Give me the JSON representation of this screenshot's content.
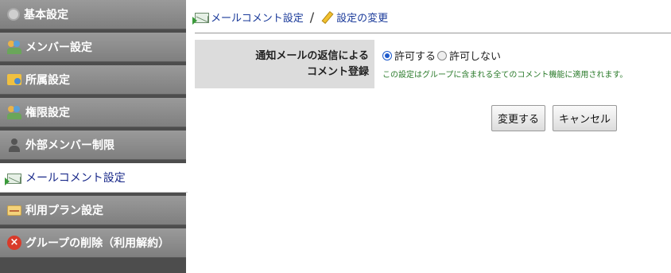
{
  "sidebar": {
    "items": [
      {
        "label": "基本設定",
        "icon": "gear-icon"
      },
      {
        "label": "メンバー設定",
        "icon": "users-icon"
      },
      {
        "label": "所属設定",
        "icon": "folder-users-icon"
      },
      {
        "label": "権限設定",
        "icon": "lock-users-icon"
      },
      {
        "label": "外部メンバー制限",
        "icon": "person-icon"
      },
      {
        "label": "メールコメント設定",
        "icon": "mail-icon",
        "active": true
      },
      {
        "label": "利用プラン設定",
        "icon": "card-icon"
      },
      {
        "label": "グループの削除（利用解約）",
        "icon": "delete-icon"
      }
    ]
  },
  "breadcrumb": {
    "parent": "メールコメント設定",
    "separator": "/",
    "current": "設定の変更"
  },
  "form": {
    "label_line1": "通知メールの返信による",
    "label_line2": "コメント登録",
    "options": [
      {
        "label": "許可する",
        "checked": true
      },
      {
        "label": "許可しない",
        "checked": false
      }
    ],
    "note": "この設定はグループに含まれる全てのコメント機能に適用されます。"
  },
  "buttons": {
    "submit": "変更する",
    "cancel": "キャンセル"
  },
  "colors": {
    "sidebar_bg": "#4d4d4d",
    "link": "#1a3a9a",
    "note": "#2a7a2a",
    "radio_accent": "#1e5acc"
  }
}
